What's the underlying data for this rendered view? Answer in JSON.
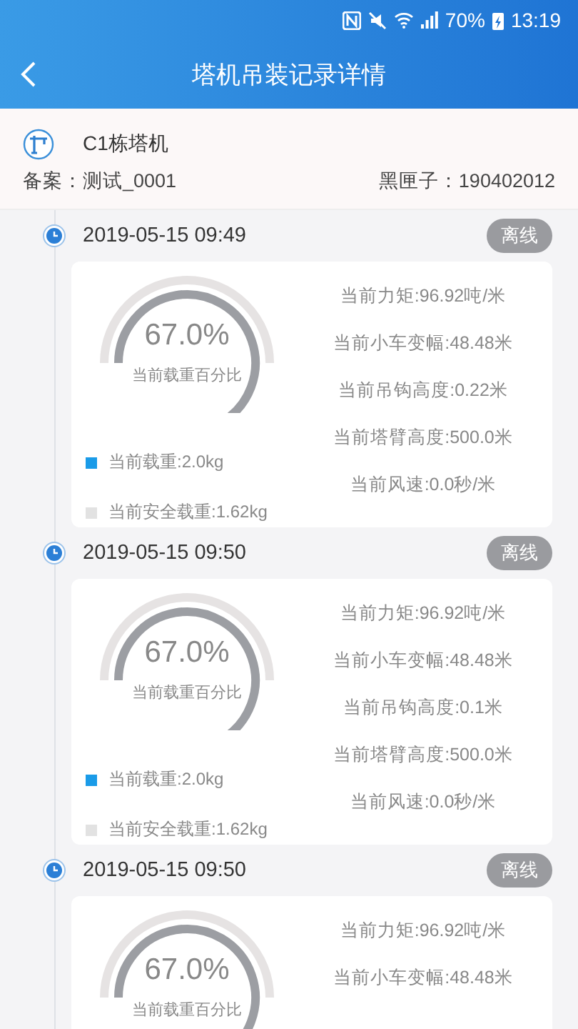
{
  "status_bar": {
    "battery": "70%",
    "time": "13:19"
  },
  "header": {
    "title": "塔机吊装记录详情"
  },
  "crane": {
    "name": "C1栋塔机",
    "record": "备案：测试_0001",
    "black_box": "黑匣子：190402012"
  },
  "records": [
    {
      "time": "2019-05-15 09:49",
      "status": "离线",
      "gauge": {
        "value": "67.0%",
        "label": "当前载重百分比"
      },
      "legend": [
        {
          "text": "当前载重:2.0kg",
          "color": "#1a9be8"
        },
        {
          "text": "当前安全载重:1.62kg",
          "color": "#e2e2e2"
        }
      ],
      "metrics": [
        "当前力矩:96.92吨/米",
        "当前小车变幅:48.48米",
        "当前吊钩高度:0.22米",
        "当前塔臂高度:500.0米",
        "当前风速:0.0秒/米"
      ]
    },
    {
      "time": "2019-05-15 09:50",
      "status": "离线",
      "gauge": {
        "value": "67.0%",
        "label": "当前载重百分比"
      },
      "legend": [
        {
          "text": "当前载重:2.0kg",
          "color": "#1a9be8"
        },
        {
          "text": "当前安全载重:1.62kg",
          "color": "#e2e2e2"
        }
      ],
      "metrics": [
        "当前力矩:96.92吨/米",
        "当前小车变幅:48.48米",
        "当前吊钩高度:0.1米",
        "当前塔臂高度:500.0米",
        "当前风速:0.0秒/米"
      ]
    },
    {
      "time": "2019-05-15 09:50",
      "status": "离线",
      "gauge": {
        "value": "67.0%",
        "label": "当前载重百分比"
      },
      "metrics": [
        "当前力矩:96.92吨/米",
        "当前小车变幅:48.48米"
      ]
    }
  ]
}
